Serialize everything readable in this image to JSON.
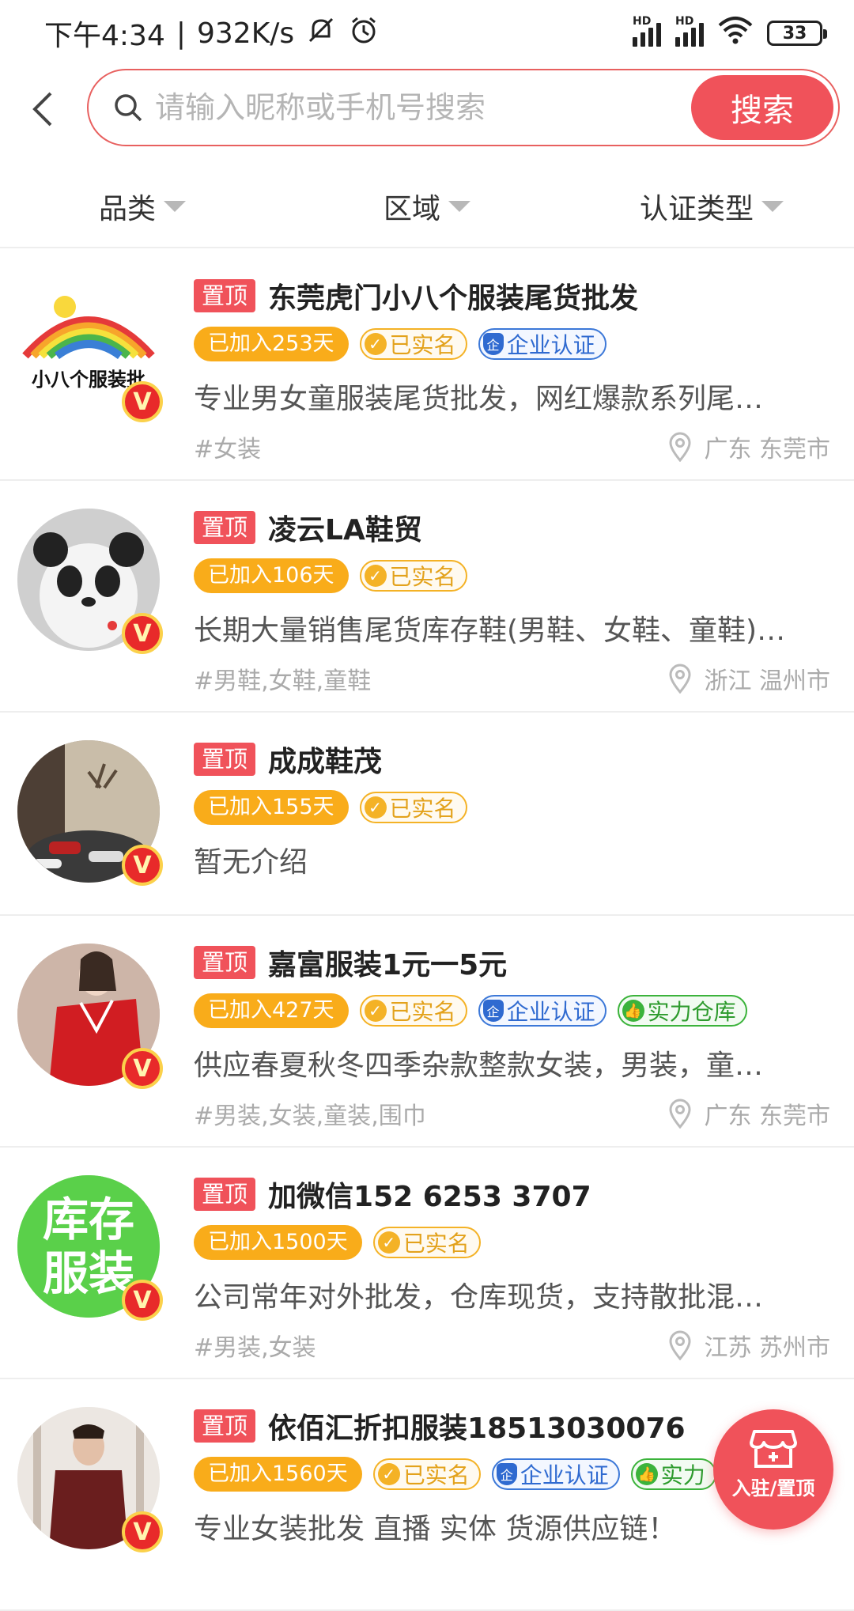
{
  "status_bar": {
    "time": "下午4:34",
    "separator": "|",
    "speed": "932K/s",
    "battery": "33",
    "hd1": "HD",
    "hd2": "HD"
  },
  "search": {
    "placeholder": "请输入昵称或手机号搜索",
    "button_label": "搜索"
  },
  "filters": [
    {
      "label": "品类"
    },
    {
      "label": "区域"
    },
    {
      "label": "认证类型"
    }
  ],
  "list": [
    {
      "top_label": "置顶",
      "name": "东莞虎门小八个服装尾货批发",
      "days": "已加入253天",
      "verified": "已实名",
      "enterprise": "企业认证",
      "warehouse": "",
      "desc": "专业男女童服装尾货批发，网红爆款系列尾…",
      "tags": "#女装",
      "location": "广东  东莞市",
      "avatar_text": "小八个服装批"
    },
    {
      "top_label": "置顶",
      "name": "凌云LA鞋贸",
      "days": "已加入106天",
      "verified": "已实名",
      "enterprise": "",
      "warehouse": "",
      "desc": "长期大量销售尾货库存鞋(男鞋、女鞋、童鞋)…",
      "tags": "#男鞋,女鞋,童鞋",
      "location": "浙江  温州市"
    },
    {
      "top_label": "置顶",
      "name": "成成鞋茂",
      "days": "已加入155天",
      "verified": "已实名",
      "enterprise": "",
      "warehouse": "",
      "desc": "暂无介绍",
      "tags": "",
      "location": ""
    },
    {
      "top_label": "置顶",
      "name": "嘉富服装1元一5元",
      "days": "已加入427天",
      "verified": "已实名",
      "enterprise": "企业认证",
      "warehouse": "实力仓库",
      "desc": "供应春夏秋冬四季杂款整款女装，男装，童…",
      "tags": "#男装,女装,童装,围巾",
      "location": "广东  东莞市"
    },
    {
      "top_label": "置顶",
      "name": "加微信152 6253 3707",
      "days": "已加入1500天",
      "verified": "已实名",
      "enterprise": "",
      "warehouse": "",
      "desc": "公司常年对外批发，仓库现货，支持散批混…",
      "tags": "#男装,女装",
      "location": "江苏  苏州市",
      "avatar_text": "库存服装"
    },
    {
      "top_label": "置顶",
      "name": "依佰汇折扣服装18513030076",
      "days": "已加入1560天",
      "verified": "已实名",
      "enterprise": "企业认证",
      "warehouse": "实力",
      "desc": "专业女装批发 直播 实体 货源供应链！",
      "tags": "",
      "location": ""
    }
  ],
  "fab": {
    "label": "入驻/置顶"
  },
  "colors": {
    "accent": "#f0525a",
    "days_badge": "#f9ac1a",
    "verified": "#f4b226",
    "enterprise": "#2f6ad0",
    "warehouse": "#3bb33b"
  }
}
